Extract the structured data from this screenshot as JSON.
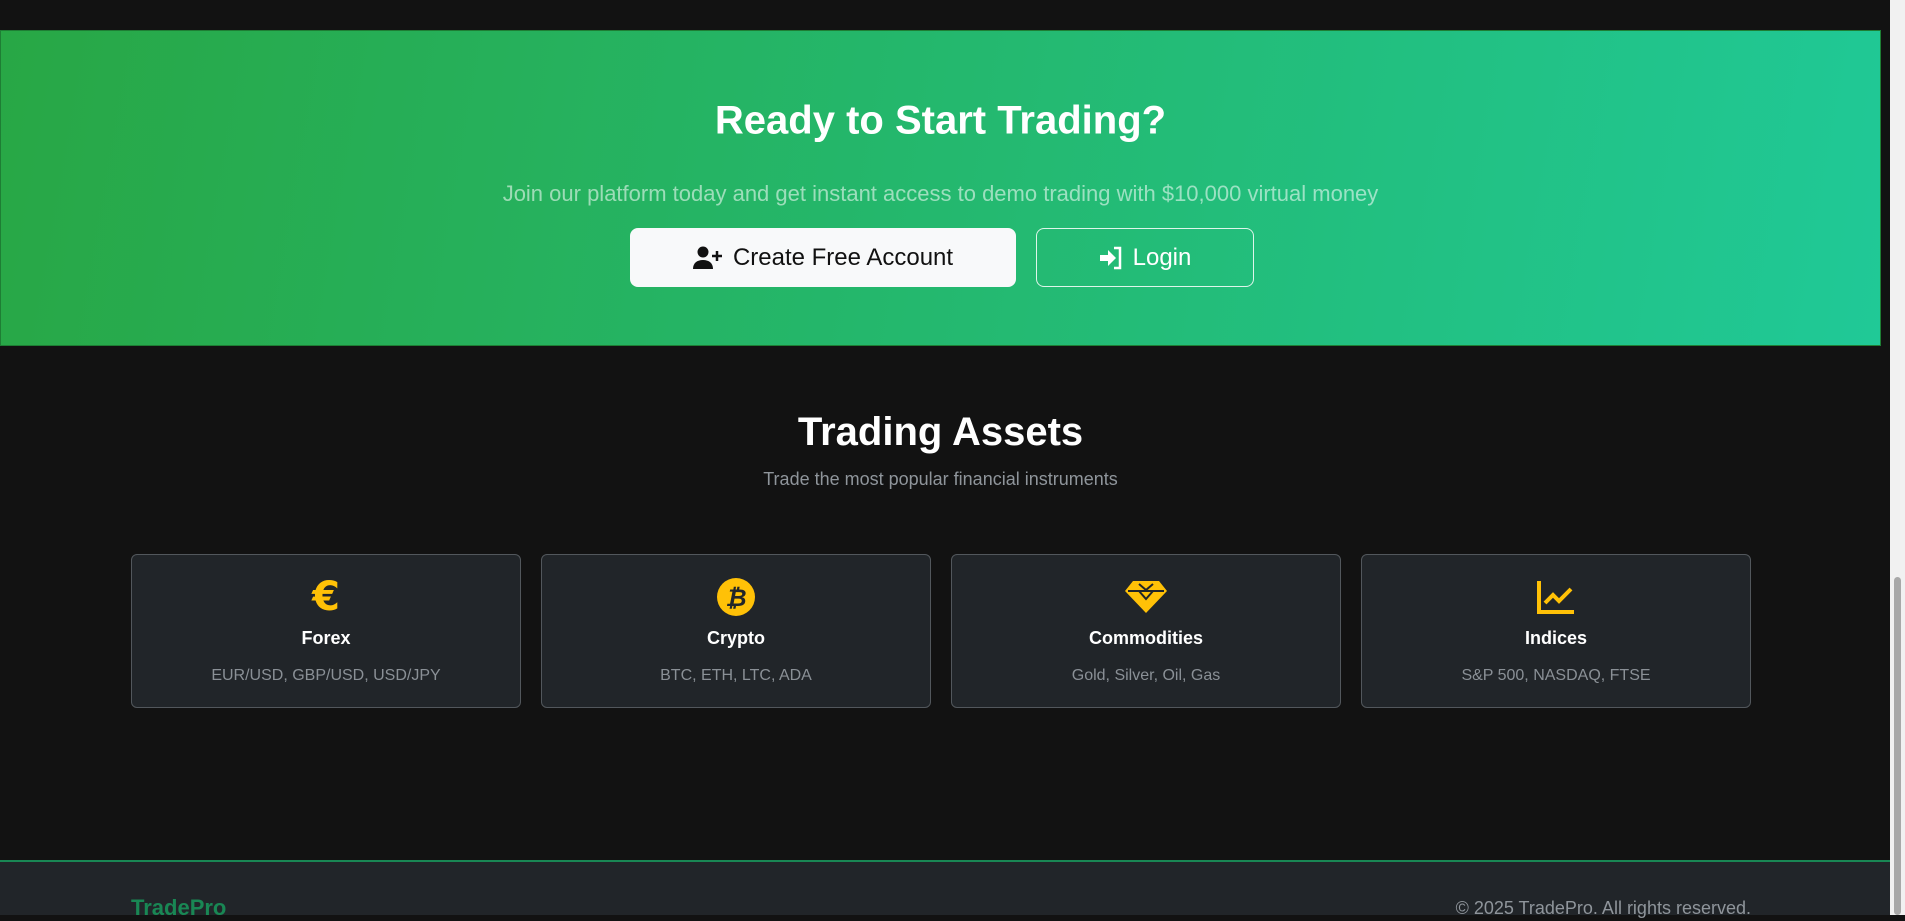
{
  "hero": {
    "title": "Ready to Start Trading?",
    "subtitle": "Join our platform today and get instant access to demo trading with $10,000 virtual money",
    "create_label": "Create Free Account",
    "login_label": "Login"
  },
  "assets": {
    "title": "Trading Assets",
    "subtitle": "Trade the most popular financial instruments",
    "items": [
      {
        "icon": "euro-icon",
        "title": "Forex",
        "desc": "EUR/USD, GBP/USD, USD/JPY"
      },
      {
        "icon": "bitcoin-icon",
        "title": "Crypto",
        "desc": "BTC, ETH, LTC, ADA"
      },
      {
        "icon": "gem-icon",
        "title": "Commodities",
        "desc": "Gold, Silver, Oil, Gas"
      },
      {
        "icon": "chart-line-icon",
        "title": "Indices",
        "desc": "S&P 500, NASDAQ, FTSE"
      }
    ]
  },
  "footer": {
    "brand": "TradePro",
    "copyright": "© 2025 TradePro. All rights reserved."
  },
  "colors": {
    "accent": "#28a745",
    "icon": "#ffc107",
    "bg": "#121212",
    "card": "#212529"
  }
}
